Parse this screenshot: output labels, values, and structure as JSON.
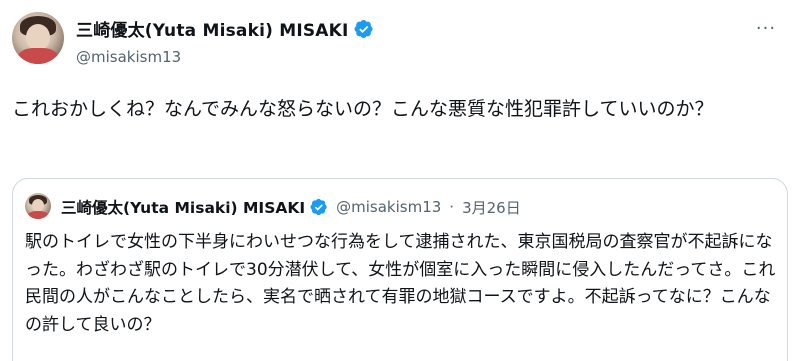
{
  "tweet": {
    "author": {
      "display_name": "三崎優太(Yuta Misaki) MISAKI",
      "handle": "@misakism13",
      "verified": true
    },
    "text": "これおかしくね？なんでみんな怒らないの？こんな悪質な性犯罪許していいのか？"
  },
  "quoted_tweet": {
    "author": {
      "display_name": "三崎優太(Yuta Misaki) MISAKI",
      "handle": "@misakism13",
      "verified": true
    },
    "separator": "·",
    "date": "3月26日",
    "text": "駅のトイレで女性の下半身にわいせつな行為をして逮捕された、東京国税局の査察官が不起訴になった。わざわざ駅のトイレで30分潜伏して、女性が個室に入った瞬間に侵入したんだってさ。これ民間の人がこんなことしたら、実名で晒されて有罪の地獄コースですよ。不起訴ってなに？こんなの許して良いの？"
  },
  "colors": {
    "verified_blue": "#1d9bf0",
    "secondary_text": "#536471",
    "border": "#cfd9de"
  },
  "icons": {
    "verified": "verified-badge-icon",
    "more": "more-options-icon"
  },
  "more_label": "···"
}
